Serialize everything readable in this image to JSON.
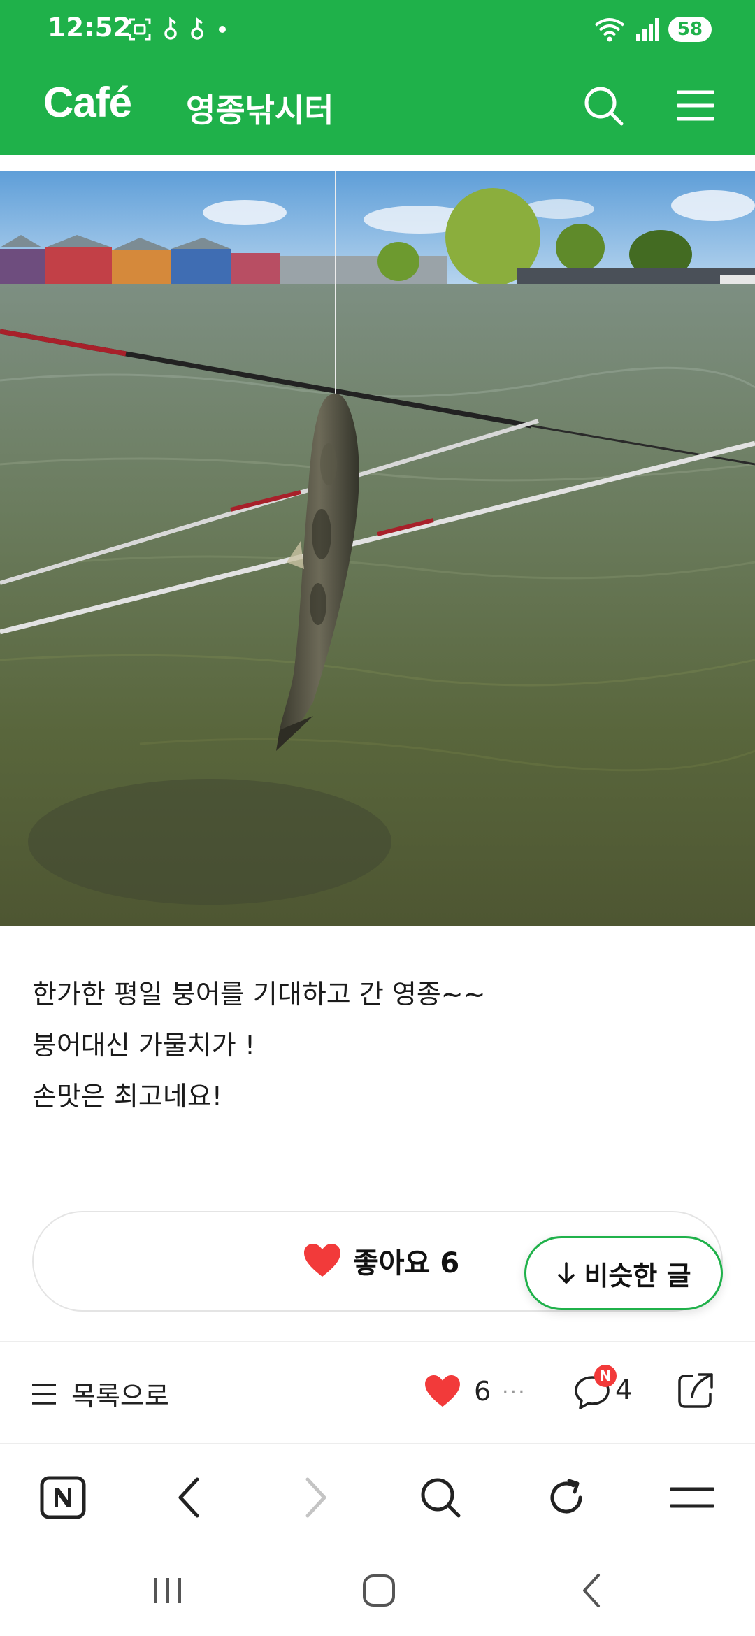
{
  "status_bar": {
    "time": "12:52",
    "battery": "58",
    "left_icons": [
      "screenshot-icon",
      "notification-icon",
      "notification-icon",
      "dot-icon"
    ],
    "right_icons": [
      "wifi-icon",
      "signal-icon"
    ]
  },
  "header": {
    "logo": "Café",
    "cafe_name": "영종낚시터",
    "icons": [
      "search-icon",
      "menu-icon"
    ],
    "color": "#1fb14a"
  },
  "post": {
    "lines": [
      "한가한 평일 붕어를 기대하고 간 영종~~",
      "붕어대신 가물치가 !",
      "손맛은 최고네요!"
    ]
  },
  "like_box": {
    "label": "좋아요 6",
    "heart_color": "#f23a3a"
  },
  "similar_button": {
    "label": "비슷한 글"
  },
  "post_footer": {
    "back_label": "목록으로",
    "like_count": "6",
    "more": "···",
    "comment_badge": "N",
    "comment_count": "4"
  },
  "browser_bar": {
    "icons": [
      "naver-home-icon",
      "back-arrow-icon",
      "forward-arrow-icon",
      "search-icon",
      "refresh-icon",
      "menu-icon"
    ]
  },
  "system_nav": {
    "icons": [
      "recent-apps-icon",
      "home-icon",
      "back-icon"
    ]
  }
}
